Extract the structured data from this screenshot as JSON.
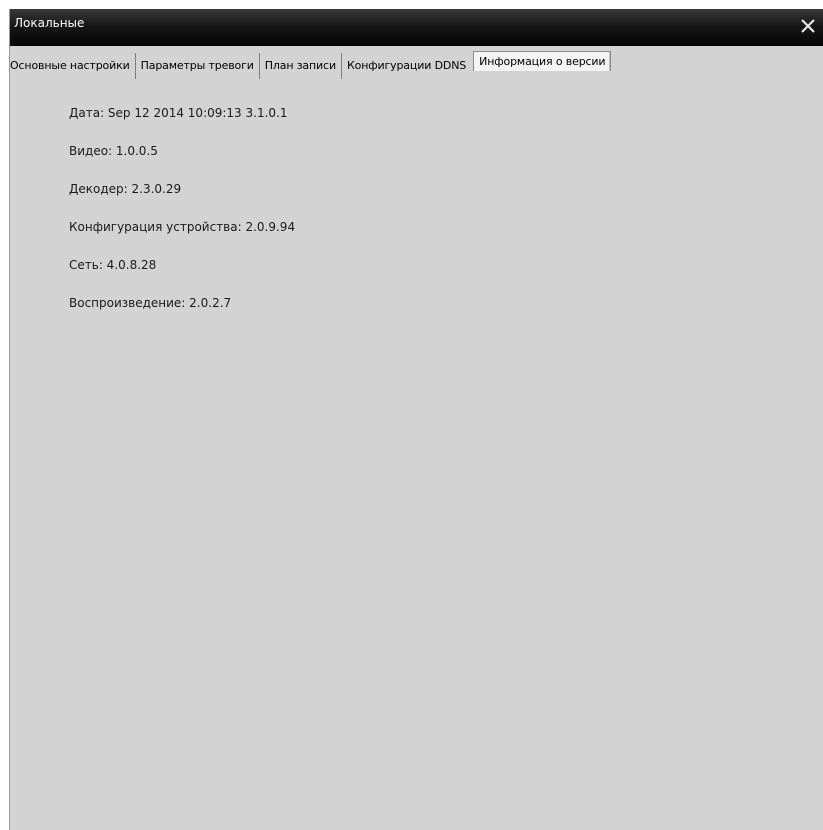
{
  "window": {
    "title": "Локальные"
  },
  "tabs": [
    {
      "label": "Основные настройки"
    },
    {
      "label": "Параметры тревоги"
    },
    {
      "label": "План записи"
    },
    {
      "label": "Конфигурации DDNS"
    },
    {
      "label": "Информация о версии",
      "active": true
    }
  ],
  "version_info": [
    {
      "text": "Дата: Sep 12 2014 10:09:13   3.1.0.1"
    },
    {
      "text": "Видео: 1.0.0.5"
    },
    {
      "text": "Декодер: 2.3.0.29"
    },
    {
      "text": "Конфигурация устройства: 2.0.9.94"
    },
    {
      "text": "Сеть: 4.0.8.28"
    },
    {
      "text": "Воспроизведение: 2.0.2.7"
    }
  ],
  "icons": {
    "close": "close-icon"
  }
}
